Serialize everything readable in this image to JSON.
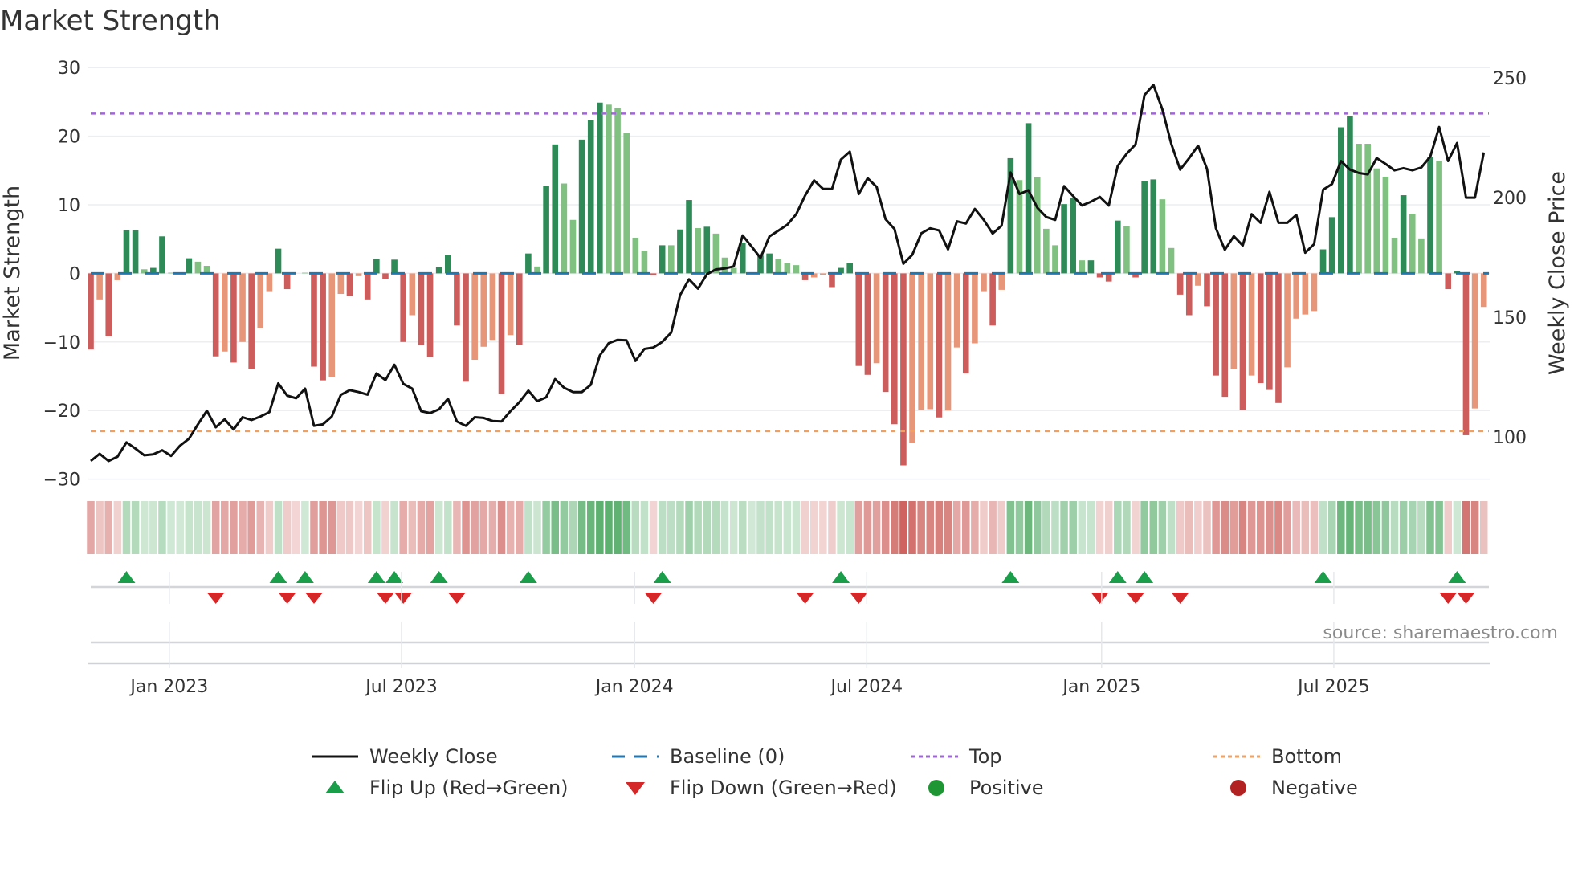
{
  "title": "Market Strength",
  "source": "source: sharemaestro.com",
  "legend": {
    "weekly_close": "Weekly Close",
    "baseline": "Baseline (0)",
    "top": "Top",
    "bottom": "Bottom",
    "flip_up": "Flip Up (Red→Green)",
    "flip_down": "Flip Down (Green→Red)",
    "positive": "Positive",
    "negative": "Negative"
  },
  "colors": {
    "bar_dark_green": "#2e8b57",
    "bar_light_green": "#80c080",
    "bar_dark_red": "#cd5c5c",
    "bar_light_red": "#e8967a",
    "baseline": "#1f77b4",
    "top": "#a066d8",
    "bottom": "#f0a060",
    "price": "#111111",
    "flip_up": "#1a9e4a",
    "flip_down": "#d62728",
    "positive": "#1e9634",
    "negative": "#b22222"
  },
  "chart_data": {
    "type": "bar",
    "title": "Market Strength",
    "ylabel": "Market Strength",
    "y2label": "Weekly Close Price",
    "ylim": [
      -30,
      30
    ],
    "y2lim": [
      82.3,
      254.2
    ],
    "y_ticks": [
      "30",
      "20",
      "10",
      "0",
      "−10",
      "−20",
      "−30"
    ],
    "y_tick_values": [
      30,
      20,
      10,
      0,
      -10,
      -20,
      -30
    ],
    "y2_ticks": [
      "250",
      "200",
      "150",
      "100"
    ],
    "y2_tick_values": [
      250,
      200,
      150,
      100
    ],
    "x_ticks": [
      {
        "label": "Jan 2023",
        "week_index": 9.8
      },
      {
        "label": "Jul 2023",
        "week_index": 35.8
      },
      {
        "label": "Jan 2024",
        "week_index": 61.9
      },
      {
        "label": "Jul 2024",
        "week_index": 87.9
      },
      {
        "label": "Jan 2025",
        "week_index": 114.2
      },
      {
        "label": "Jul 2025",
        "week_index": 140.2
      }
    ],
    "top_level": 23.3,
    "bottom_level": -23.0,
    "baseline": 0,
    "grid": true,
    "legend_position": "bottom",
    "strength": [
      -11.1,
      -3.8,
      -9.2,
      -1.0,
      6.3,
      6.3,
      0.6,
      0.8,
      5.4,
      0.1,
      0,
      2.2,
      1.7,
      1.1,
      -12.1,
      -11.4,
      -13.0,
      -10.0,
      -14.0,
      -8.0,
      -2.6,
      3.6,
      -2.3,
      0,
      0.1,
      -13.6,
      -15.6,
      -15.1,
      -3.0,
      -3.3,
      -0.4,
      -3.8,
      2.1,
      -0.8,
      2.0,
      -10.0,
      -6.1,
      -10.5,
      -12.2,
      0.9,
      2.7,
      -7.6,
      -15.8,
      -12.6,
      -10.7,
      -9.7,
      -17.6,
      -9.0,
      -10.4,
      2.9,
      1.0,
      12.8,
      18.8,
      13.1,
      7.8,
      19.5,
      22.3,
      24.9,
      24.6,
      24.1,
      20.5,
      5.2,
      3.3,
      -0.3,
      4.1,
      4.1,
      6.4,
      10.7,
      6.6,
      6.8,
      5.8,
      2.3,
      0.8,
      4.5,
      0,
      2.6,
      2.9,
      2.1,
      1.5,
      1.2,
      -1.0,
      -0.6,
      -0.2,
      -2.0,
      0.8,
      1.5,
      -13.5,
      -14.8,
      -13.1,
      -17.3,
      -22.0,
      -28.0,
      -24.7,
      -19.9,
      -19.8,
      -21.0,
      -20.0,
      -10.8,
      -14.6,
      -10.2,
      -2.6,
      -7.6,
      -2.4,
      16.8,
      13.6,
      21.9,
      14.0,
      6.5,
      4.1,
      10.1,
      11.0,
      1.9,
      1.9,
      -0.6,
      -1.2,
      7.7,
      6.9,
      -0.6,
      13.4,
      13.7,
      10.8,
      3.7,
      -3.1,
      -6.1,
      -1.8,
      -4.8,
      -14.9,
      -18.0,
      -13.9,
      -19.9,
      -14.9,
      -16.0,
      -17.0,
      -18.9,
      -13.7,
      -6.6,
      -6.0,
      -5.5,
      3.5,
      8.2,
      21.3,
      22.9,
      18.9,
      18.9,
      15.3,
      14.1,
      5.2,
      11.4,
      8.7,
      5.1,
      17.0,
      16.4,
      -2.3,
      0.4,
      -23.6,
      -19.7,
      -4.9
    ],
    "shade": "dldlddlddllldlldldlldlldddlldldddddlddddddlllldldddlddllddd lllllddlddldllldlddllldllddddddlddlllddlllddlldldlldlddlllddllddddd dldddllddddddllllldlldddddldddlld",
    "shade_list": [
      "d",
      "l",
      "d",
      "l",
      "d",
      "d",
      "l",
      "d",
      "d",
      "l",
      "l",
      "d",
      "l",
      "l",
      "d",
      "l",
      "d",
      "l",
      "d",
      "l",
      "l",
      "d",
      "d",
      "l",
      "l",
      "d",
      "d",
      "l",
      "l",
      "d",
      "l",
      "d",
      "d",
      "d",
      "d",
      "d",
      "l",
      "d",
      "d",
      "d",
      "d",
      "d",
      "d",
      "l",
      "l",
      "l",
      "d",
      "l",
      "d",
      "d",
      "l",
      "d",
      "d",
      "l",
      "l",
      "d",
      "d",
      "d",
      "l",
      "l",
      "l",
      "l",
      "l",
      "d",
      "d",
      "l",
      "d",
      "d",
      "l",
      "d",
      "l",
      "l",
      "l",
      "d",
      "l",
      "d",
      "d",
      "l",
      "l",
      "l",
      "d",
      "l",
      "l",
      "d",
      "d",
      "d",
      "d",
      "d",
      "l",
      "d",
      "d",
      "d",
      "l",
      "l",
      "l",
      "d",
      "l",
      "l",
      "d",
      "l",
      "l",
      "d",
      "l",
      "d",
      "l",
      "d",
      "l",
      "l",
      "l",
      "d",
      "d",
      "l",
      "d",
      "d",
      "d",
      "d",
      "l",
      "d",
      "d",
      "d",
      "l",
      "l",
      "d",
      "d",
      "l",
      "d",
      "d",
      "d",
      "l",
      "d",
      "l",
      "d",
      "d",
      "d",
      "l",
      "l",
      "l",
      "l",
      "d",
      "d",
      "d",
      "d",
      "l",
      "l",
      "l",
      "l",
      "l",
      "d",
      "l",
      "l",
      "d",
      "l",
      "d",
      "d",
      "d",
      "l",
      "l"
    ],
    "weekly_close": [
      89.9,
      92.9,
      89.9,
      91.7,
      97.7,
      95.1,
      92.3,
      92.7,
      94.4,
      92.0,
      96.3,
      99.2,
      105.2,
      110.9,
      104.0,
      107.3,
      103.1,
      108.2,
      107.0,
      108.5,
      110.3,
      122.3,
      117.2,
      116.1,
      120.1,
      104.6,
      105.2,
      108.5,
      117.5,
      119.5,
      118.7,
      117.6,
      126.5,
      123.7,
      130.1,
      122.1,
      120.1,
      110.7,
      109.9,
      111.5,
      115.9,
      106.4,
      104.6,
      108.2,
      107.9,
      106.6,
      106.4,
      110.7,
      114.5,
      119.3,
      114.9,
      116.5,
      124.1,
      120.5,
      118.7,
      118.7,
      121.7,
      133.9,
      139.1,
      140.5,
      140.3,
      131.7,
      136.7,
      137.3,
      139.7,
      143.5,
      159.2,
      165.8,
      161.9,
      167.9,
      169.9,
      170.3,
      171.2,
      184.1,
      179.5,
      174.7,
      183.7,
      186.1,
      188.6,
      193.0,
      200.8,
      207.1,
      203.6,
      203.5,
      215.8,
      219.1,
      201.4,
      208.0,
      204.4,
      190.9,
      186.8,
      172.3,
      176.0,
      185.0,
      187.1,
      186.2,
      178.3,
      190.0,
      189.1,
      195.2,
      190.6,
      184.9,
      188.2,
      210.4,
      201.4,
      203.0,
      195.7,
      191.8,
      190.6,
      204.7,
      200.6,
      196.6,
      198.2,
      200.2,
      196.6,
      213.1,
      218.2,
      222.1,
      242.8,
      247.0,
      236.8,
      222.4,
      211.6,
      216.4,
      221.6,
      211.9,
      187.1,
      178.1,
      183.8,
      179.9,
      193.0,
      189.4,
      202.3,
      189.4,
      189.4,
      192.7,
      176.9,
      180.5,
      203.2,
      205.6,
      215.2,
      211.6,
      210.2,
      209.6,
      216.4,
      214.0,
      211.3,
      212.2,
      211.3,
      212.5,
      217.0,
      229.4,
      215.2,
      222.7,
      199.9,
      199.9,
      218.8
    ],
    "flip_up_weeks": [
      5,
      22,
      25,
      33,
      35,
      40,
      50,
      65,
      85,
      104,
      116,
      119,
      139,
      154
    ],
    "flip_down_weeks": [
      15,
      23,
      26,
      34,
      36,
      42,
      64,
      81,
      87,
      114,
      118,
      123,
      153,
      155
    ]
  }
}
